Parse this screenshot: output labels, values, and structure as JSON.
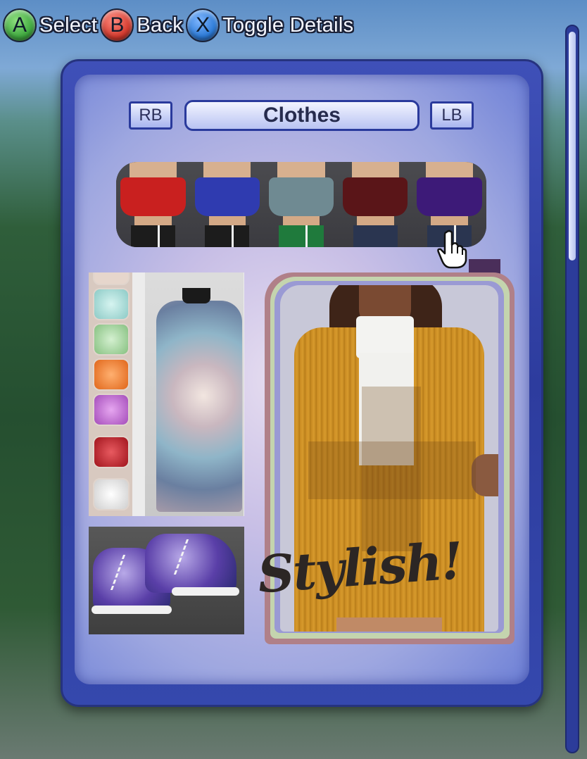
{
  "hints": [
    {
      "button": "A",
      "label": "Select",
      "color": "#3fa83f"
    },
    {
      "button": "B",
      "label": "Back",
      "color": "#d23a2e"
    },
    {
      "button": "X",
      "label": "Toggle Details",
      "color": "#2c7ad6"
    }
  ],
  "tabs": {
    "left": "RB",
    "title": "Clothes",
    "right": "LB"
  },
  "strip": {
    "items": [
      {
        "name": "red-top",
        "color": "#c9201f",
        "pants": "#1c1c1c"
      },
      {
        "name": "blue-top",
        "color": "#2f3bb0",
        "pants": "#1c1c1c"
      },
      {
        "name": "gray-top",
        "color": "#6f8a92",
        "pants": "#1f7a3c"
      },
      {
        "name": "maroon-top",
        "color": "#5a1518",
        "pants": "#2a3550"
      },
      {
        "name": "purple-top",
        "color": "#3d1a78",
        "pants": "#2a3550"
      }
    ]
  },
  "selected_swatch_color": "#4a2e5a",
  "sequin_swatches": [
    "#a8dcd8",
    "#9fd29a",
    "#e8741e",
    "#b45fc6",
    "#b01c26",
    "#e6e6e6"
  ],
  "stylish_text": "Stylish!",
  "colors": {
    "panel_border": "#2d3c9e",
    "scrollbar": "#2c3c9a"
  }
}
